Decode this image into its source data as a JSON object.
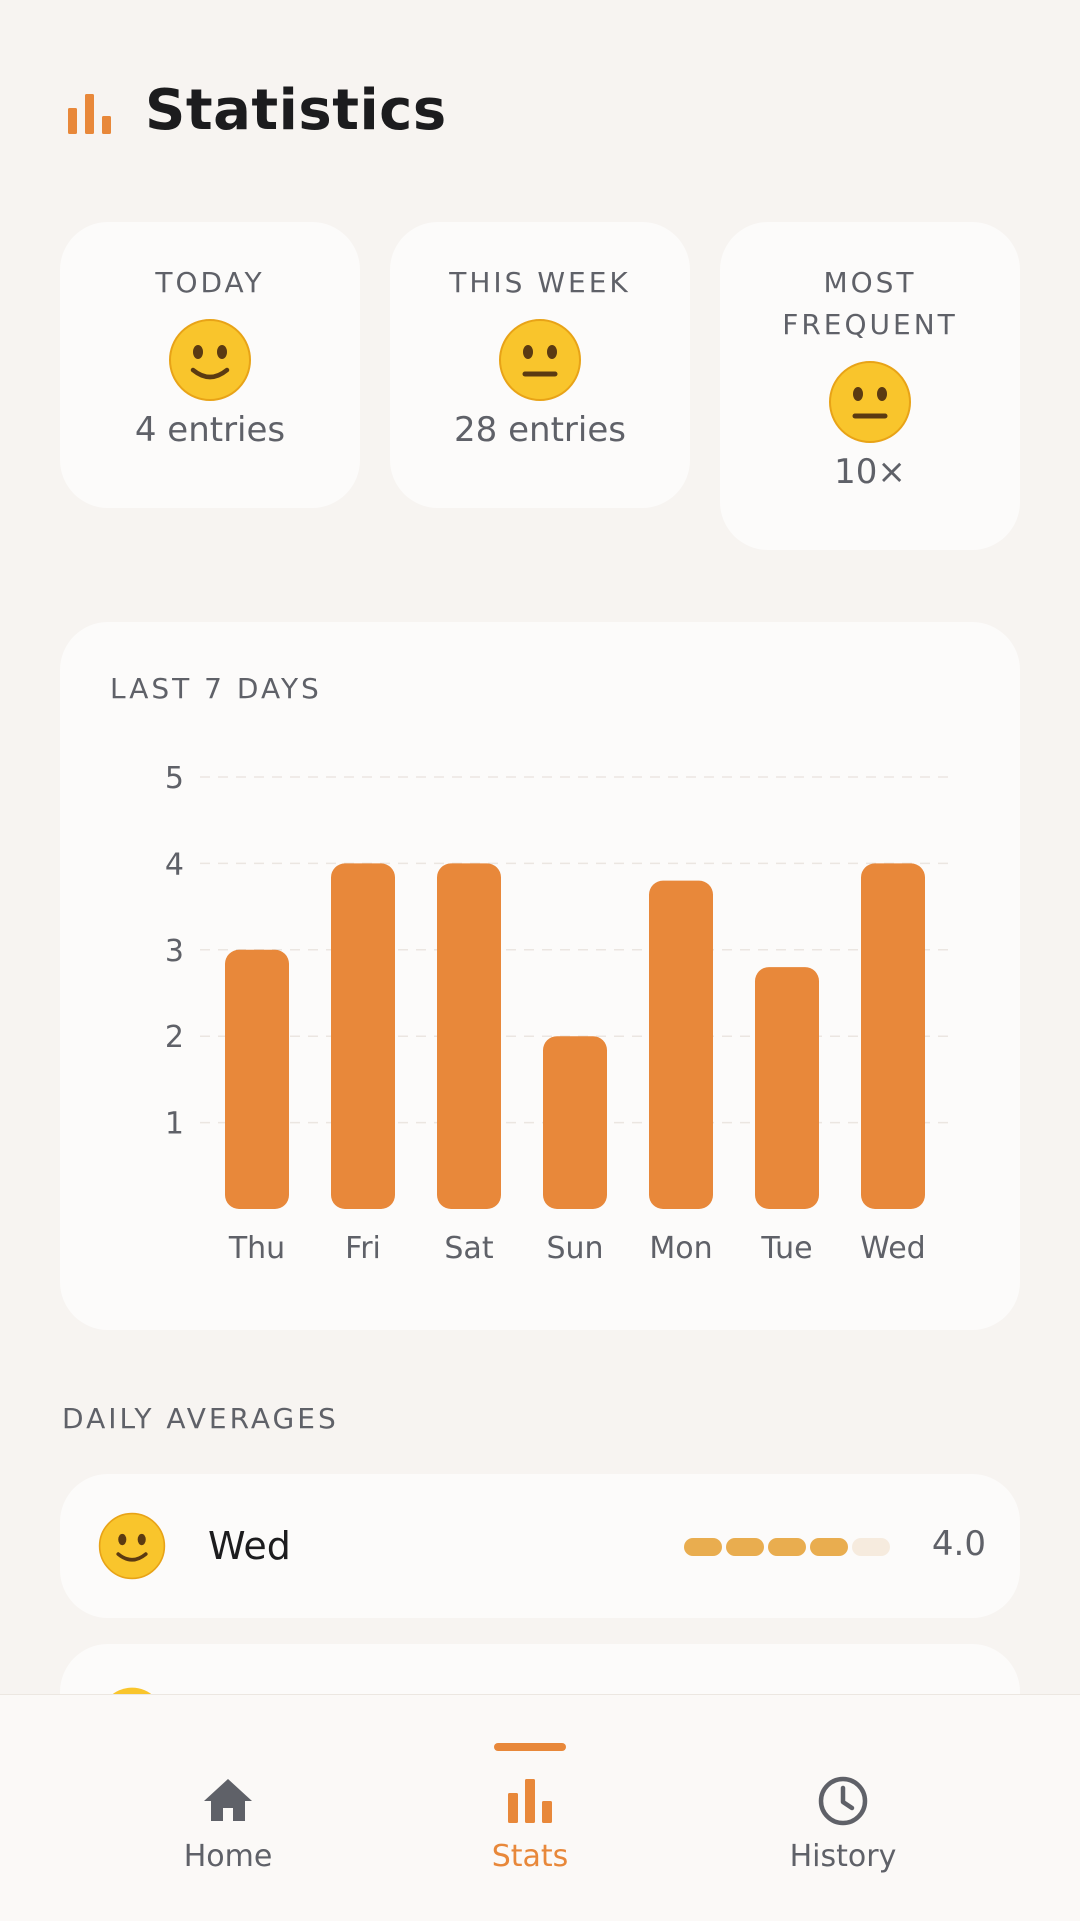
{
  "header": {
    "title": "Statistics",
    "icon": "bar-chart-icon"
  },
  "stats": [
    {
      "label": "TODAY",
      "emoji": "slightly-smiling-face",
      "value": "4 entries"
    },
    {
      "label": "THIS WEEK",
      "emoji": "neutral-face",
      "value": "28 entries"
    },
    {
      "label_lines": [
        "MOST",
        "FREQUENT"
      ],
      "emoji": "neutral-face",
      "value": "10×"
    }
  ],
  "chart_data": {
    "type": "bar",
    "title": "LAST 7 DAYS",
    "categories": [
      "Thu",
      "Fri",
      "Sat",
      "Sun",
      "Mon",
      "Tue",
      "Wed"
    ],
    "values": [
      3.0,
      4.0,
      4.0,
      2.0,
      3.8,
      2.8,
      4.0
    ],
    "yticks": [
      1,
      2,
      3,
      4,
      5
    ],
    "ylim": [
      0,
      5
    ],
    "grid": true,
    "bar_color": "#e8883a"
  },
  "daily_averages": {
    "title": "DAILY AVERAGES",
    "rows": [
      {
        "emoji": "slightly-smiling-face",
        "day": "Wed",
        "value": "4.0",
        "level": 4,
        "max": 5
      }
    ]
  },
  "tabs": [
    {
      "label": "Home",
      "icon": "home-icon",
      "active": false
    },
    {
      "label": "Stats",
      "icon": "bar-chart-icon",
      "active": true
    },
    {
      "label": "History",
      "icon": "clock-icon",
      "active": false
    }
  ],
  "colors": {
    "accent": "#e8883a",
    "dot_active": "#e9ad4f",
    "dot_inactive": "#f6ebde",
    "inactive_tab": "#5f6168",
    "background": "#f7f4f1"
  }
}
